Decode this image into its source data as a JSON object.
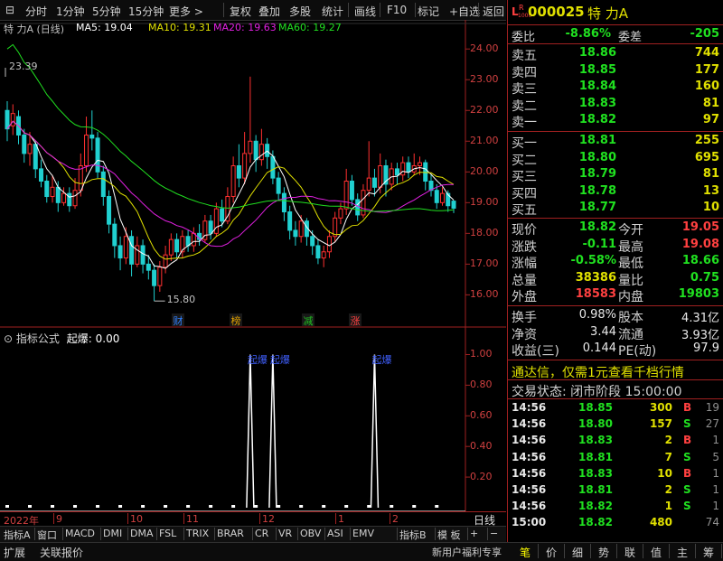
{
  "toolbar": {
    "items": [
      "分时",
      "1分钟",
      "5分钟",
      "15分钟",
      "更多 >",
      "复权",
      "叠加",
      "多股",
      "统计",
      "画线",
      "F10",
      "标记",
      "+自选",
      "返回"
    ]
  },
  "chart": {
    "title": "特 力A (日线)",
    "ma_labels": [
      {
        "text": "MA5: 19.04",
        "color": "#ffffff"
      },
      {
        "text": "MA10: 19.31",
        "color": "#e0e000"
      },
      {
        "text": "MA20: 19.63",
        "color": "#e020e0"
      },
      {
        "text": "MA60: 19.27",
        "color": "#20e020"
      }
    ],
    "price_ticks": [
      "24.00",
      "23.00",
      "22.00",
      "21.00",
      "20.00",
      "19.00",
      "18.00",
      "17.00",
      "16.00"
    ],
    "high_marker": "23.39",
    "low_marker": "15.80",
    "markers": [
      {
        "text": "财",
        "color": "#3080ff"
      },
      {
        "text": "榜",
        "color": "#e0a000"
      },
      {
        "text": "减",
        "color": "#20c020"
      },
      {
        "text": "涨",
        "color": "#ff4040"
      }
    ]
  },
  "indicator": {
    "title": "指标公式",
    "name": "起爆",
    "value": "0.00",
    "ticks": [
      "1.00",
      "0.80",
      "0.60",
      "0.40",
      "0.20"
    ],
    "signal_label": "起爆",
    "signals": [
      {
        "index": 43,
        "value": 1.0
      },
      {
        "index": 47,
        "value": 1.0
      },
      {
        "index": 65,
        "value": 1.0
      }
    ]
  },
  "xaxis": {
    "labels": [
      "2022年",
      "9",
      "10",
      "11",
      "12",
      "1",
      "2"
    ],
    "period": "日线"
  },
  "tabs": [
    "指标A",
    "窗口",
    "MACD",
    "DMI",
    "DMA",
    "FSL",
    "TRIX",
    "BRAR",
    "CR",
    "VR",
    "OBV",
    "ASI",
    "EMV",
    "指标B",
    "模 板",
    "+",
    "−"
  ],
  "status_bar": {
    "left": [
      "扩展",
      "关联报价"
    ],
    "promo": "新用户福利专享",
    "right_tabs": [
      "笔",
      "价",
      "细",
      "势",
      "联",
      "值",
      "主",
      "筹"
    ]
  },
  "quote": {
    "code": "000025",
    "name": "特 力A",
    "weibi_label": "委比",
    "weibi": "-8.86%",
    "weicha_label": "委差",
    "weicha": "-205",
    "asks": [
      {
        "label": "卖五",
        "price": "18.86",
        "vol": "744"
      },
      {
        "label": "卖四",
        "price": "18.85",
        "vol": "177"
      },
      {
        "label": "卖三",
        "price": "18.84",
        "vol": "160"
      },
      {
        "label": "卖二",
        "price": "18.83",
        "vol": "81"
      },
      {
        "label": "卖一",
        "price": "18.82",
        "vol": "97"
      }
    ],
    "bids": [
      {
        "label": "买一",
        "price": "18.81",
        "vol": "255"
      },
      {
        "label": "买二",
        "price": "18.80",
        "vol": "695"
      },
      {
        "label": "买三",
        "price": "18.79",
        "vol": "81"
      },
      {
        "label": "买四",
        "price": "18.78",
        "vol": "13"
      },
      {
        "label": "买五",
        "price": "18.77",
        "vol": "10"
      }
    ],
    "stats": [
      {
        "l1": "现价",
        "v1": "18.82",
        "c1": "down",
        "l2": "今开",
        "v2": "19.05",
        "c2": "up"
      },
      {
        "l1": "涨跌",
        "v1": "-0.11",
        "c1": "down",
        "l2": "最高",
        "v2": "19.08",
        "c2": "up"
      },
      {
        "l1": "涨幅",
        "v1": "-0.58%",
        "c1": "down",
        "l2": "最低",
        "v2": "18.66",
        "c2": "down"
      },
      {
        "l1": "总量",
        "v1": "38386",
        "c1": "yel",
        "l2": "量比",
        "v2": "0.75",
        "c2": "down"
      },
      {
        "l1": "外盘",
        "v1": "18583",
        "c1": "up",
        "l2": "内盘",
        "v2": "19803",
        "c2": "down"
      }
    ],
    "stats2": [
      {
        "l1": "换手",
        "v1": "0.98%",
        "l2": "股本",
        "v2": "4.31亿"
      },
      {
        "l1": "净资",
        "v1": "3.44",
        "l2": "流通",
        "v2": "3.93亿"
      },
      {
        "l1": "收益(三)",
        "v1": "0.144",
        "l2": "PE(动)",
        "v2": "97.9"
      }
    ],
    "promo": "通达信，仅需1元查看千档行情",
    "trade_status": "交易状态: 闭市阶段 15:00:00",
    "ticks": [
      {
        "time": "14:56",
        "price": "18.85",
        "pc": "down",
        "vol": "300",
        "vc": "yel",
        "bs": "B",
        "bsc": "up",
        "n": "19"
      },
      {
        "time": "14:56",
        "price": "18.80",
        "pc": "down",
        "vol": "157",
        "vc": "yel",
        "bs": "S",
        "bsc": "down",
        "n": "27"
      },
      {
        "time": "14:56",
        "price": "18.83",
        "pc": "down",
        "vol": "2",
        "vc": "yel",
        "bs": "B",
        "bsc": "up",
        "n": "1"
      },
      {
        "time": "14:56",
        "price": "18.81",
        "pc": "down",
        "vol": "7",
        "vc": "yel",
        "bs": "S",
        "bsc": "down",
        "n": "5"
      },
      {
        "time": "14:56",
        "price": "18.83",
        "pc": "down",
        "vol": "10",
        "vc": "yel",
        "bs": "B",
        "bsc": "up",
        "n": "1"
      },
      {
        "time": "14:56",
        "price": "18.81",
        "pc": "down",
        "vol": "2",
        "vc": "yel",
        "bs": "S",
        "bsc": "down",
        "n": "1"
      },
      {
        "time": "14:56",
        "price": "18.82",
        "pc": "down",
        "vol": "1",
        "vc": "yel",
        "bs": "S",
        "bsc": "down",
        "n": "1"
      },
      {
        "time": "15:00",
        "price": "18.82",
        "pc": "down",
        "vol": "480",
        "vc": "yel",
        "bs": "",
        "bsc": "down",
        "n": "74"
      }
    ]
  },
  "chart_data": {
    "type": "candlestick",
    "ylim": [
      15.6,
      24.3
    ],
    "candles": [
      [
        22.0,
        21.4,
        22.3,
        21.0
      ],
      [
        21.5,
        21.9,
        22.2,
        21.2
      ],
      [
        21.8,
        21.2,
        22.0,
        20.9
      ],
      [
        21.2,
        20.6,
        21.4,
        20.3
      ],
      [
        20.6,
        20.9,
        21.3,
        20.2
      ],
      [
        20.9,
        20.1,
        21.0,
        19.8
      ],
      [
        20.1,
        19.7,
        20.4,
        19.5
      ],
      [
        19.7,
        19.2,
        19.9,
        19.0
      ],
      [
        19.2,
        19.5,
        19.9,
        19.0
      ],
      [
        19.5,
        19.0,
        19.7,
        18.7
      ],
      [
        19.0,
        19.3,
        19.5,
        18.9
      ],
      [
        19.3,
        18.9,
        19.5,
        18.7
      ],
      [
        18.9,
        19.4,
        19.8,
        18.8
      ],
      [
        19.4,
        20.2,
        20.6,
        19.2
      ],
      [
        20.2,
        21.2,
        21.8,
        20.0
      ],
      [
        21.2,
        21.1,
        22.0,
        20.7
      ],
      [
        21.1,
        20.0,
        21.3,
        19.8
      ],
      [
        20.0,
        19.2,
        20.2,
        18.9
      ],
      [
        19.2,
        18.3,
        19.4,
        18.0
      ],
      [
        18.3,
        17.6,
        18.5,
        17.2
      ],
      [
        17.6,
        17.2,
        17.9,
        16.8
      ],
      [
        17.2,
        17.9,
        18.2,
        17.0
      ],
      [
        17.9,
        17.0,
        18.1,
        16.6
      ],
      [
        17.0,
        17.6,
        17.9,
        16.9
      ],
      [
        17.6,
        17.0,
        17.8,
        16.7
      ],
      [
        17.0,
        16.8,
        17.3,
        16.5
      ],
      [
        16.8,
        16.3,
        17.0,
        15.8
      ],
      [
        16.3,
        16.9,
        17.1,
        16.1
      ],
      [
        16.9,
        17.3,
        17.6,
        16.7
      ],
      [
        17.3,
        17.8,
        18.0,
        17.1
      ],
      [
        17.8,
        17.4,
        18.0,
        17.2
      ],
      [
        17.4,
        17.9,
        18.1,
        17.2
      ],
      [
        17.9,
        17.6,
        18.1,
        17.4
      ],
      [
        17.6,
        18.0,
        18.2,
        17.4
      ],
      [
        18.0,
        17.8,
        18.3,
        17.6
      ],
      [
        17.8,
        18.4,
        18.6,
        17.7
      ],
      [
        18.4,
        18.0,
        18.6,
        17.8
      ],
      [
        18.0,
        18.8,
        19.0,
        17.9
      ],
      [
        18.8,
        18.4,
        19.1,
        18.2
      ],
      [
        18.4,
        19.2,
        19.5,
        18.3
      ],
      [
        19.2,
        20.2,
        20.5,
        19.0
      ],
      [
        20.2,
        19.8,
        20.9,
        19.5
      ],
      [
        19.8,
        20.6,
        21.3,
        19.6
      ],
      [
        20.6,
        21.0,
        23.1,
        20.3
      ],
      [
        21.0,
        20.4,
        21.2,
        20.0
      ],
      [
        20.4,
        20.9,
        21.4,
        20.2
      ],
      [
        20.9,
        20.5,
        21.1,
        20.1
      ],
      [
        20.5,
        19.8,
        20.7,
        19.6
      ],
      [
        19.8,
        19.3,
        20.0,
        19.1
      ],
      [
        19.3,
        18.7,
        19.5,
        18.4
      ],
      [
        18.7,
        18.1,
        18.9,
        17.8
      ],
      [
        18.1,
        17.9,
        18.4,
        17.6
      ],
      [
        17.9,
        18.4,
        18.6,
        17.7
      ],
      [
        18.4,
        17.9,
        18.5,
        17.6
      ],
      [
        17.9,
        17.6,
        18.1,
        17.3
      ],
      [
        17.6,
        17.2,
        17.8,
        17.0
      ],
      [
        17.2,
        17.4,
        17.6,
        16.9
      ],
      [
        17.4,
        17.9,
        18.1,
        17.2
      ],
      [
        17.9,
        18.5,
        18.7,
        17.7
      ],
      [
        18.5,
        18.8,
        19.0,
        18.3
      ],
      [
        18.8,
        19.7,
        20.1,
        18.6
      ],
      [
        19.7,
        19.1,
        19.9,
        18.9
      ],
      [
        19.1,
        18.6,
        19.3,
        18.4
      ],
      [
        18.6,
        19.4,
        19.6,
        18.5
      ],
      [
        19.4,
        19.8,
        21.0,
        19.2
      ],
      [
        19.8,
        19.5,
        20.1,
        19.2
      ],
      [
        19.5,
        20.2,
        20.6,
        19.3
      ],
      [
        20.2,
        19.6,
        20.4,
        19.2
      ],
      [
        19.6,
        20.1,
        20.3,
        19.4
      ],
      [
        20.1,
        19.9,
        20.3,
        19.6
      ],
      [
        19.9,
        20.3,
        20.5,
        19.7
      ],
      [
        20.3,
        20.0,
        20.5,
        19.8
      ],
      [
        20.0,
        20.2,
        20.6,
        19.9
      ],
      [
        20.2,
        20.3,
        20.5,
        19.9
      ],
      [
        20.3,
        19.7,
        20.4,
        19.4
      ],
      [
        19.7,
        19.4,
        19.9,
        19.2
      ],
      [
        19.4,
        19.0,
        19.6,
        18.8
      ],
      [
        19.0,
        19.3,
        19.5,
        18.9
      ],
      [
        19.3,
        18.9,
        19.4,
        18.7
      ],
      [
        19.05,
        18.82,
        19.08,
        18.66
      ]
    ]
  }
}
